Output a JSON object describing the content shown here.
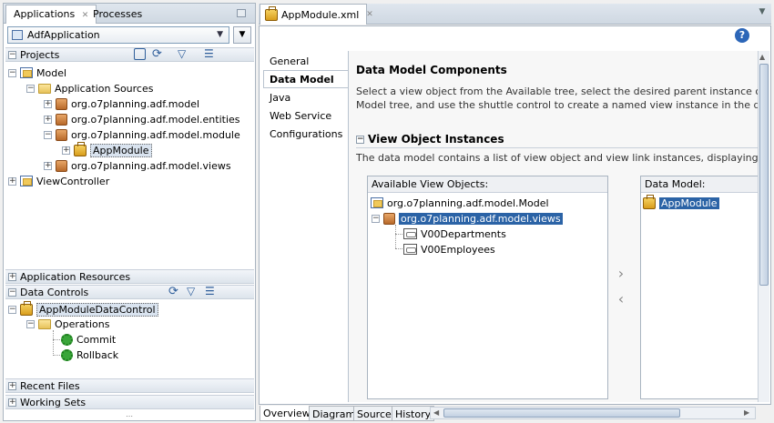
{
  "left_panel": {
    "tabs": [
      "Applications",
      "Processes"
    ],
    "app_selector": "AdfApplication",
    "projects": {
      "title": "Projects",
      "tree": {
        "model": "Model",
        "app_sources": "Application Sources",
        "pkg_model": "org.o7planning.adf.model",
        "pkg_entities": "org.o7planning.adf.model.entities",
        "pkg_module": "org.o7planning.adf.model.module",
        "app_module": "AppModule",
        "pkg_views": "org.o7planning.adf.model.views",
        "view_controller": "ViewController"
      }
    },
    "application_resources": "Application Resources",
    "data_controls": {
      "title": "Data Controls",
      "tree": {
        "control": "AppModuleDataControl",
        "operations": "Operations",
        "commit": "Commit",
        "rollback": "Rollback"
      }
    },
    "recent_files": "Recent Files",
    "working_sets": "Working Sets"
  },
  "editor": {
    "tab_title": "AppModule.xml",
    "nav": [
      "General",
      "Data Model",
      "Java",
      "Web Service",
      "Configurations"
    ],
    "heading": "Data Model Components",
    "description_1": "Select a view object from the Available tree, select the desired parent instance or applicatio",
    "description_2": "Model tree, and use the shuttle control to create a named view instance in the data model.",
    "section_title": "View Object Instances",
    "section_desc": "The data model contains a list of view object and view link instances, displaying master-deta",
    "available": {
      "label": "Available View Objects:",
      "root": "org.o7planning.adf.model.Model",
      "pkg": "org.o7planning.adf.model.views",
      "items": [
        "V00Departments",
        "V00Employees"
      ]
    },
    "data_model": {
      "label": "Data Model:",
      "root": "AppModule"
    },
    "bottom_tabs": [
      "Overview",
      "Diagram",
      "Source",
      "History"
    ]
  }
}
